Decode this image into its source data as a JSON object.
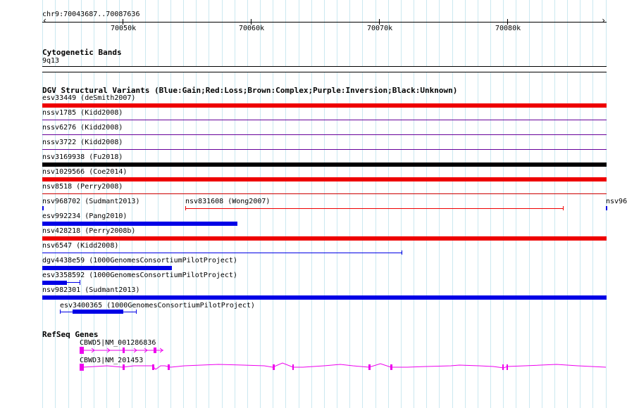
{
  "ruler": {
    "region": "chr9:70043687..70087636",
    "ticks": [
      "70050k",
      "70060k",
      "70070k",
      "70080k"
    ]
  },
  "cytoband": {
    "title": "Cytogenetic Bands",
    "band": "9q13"
  },
  "dgv": {
    "title": "DGV Structural Variants (Blue:Gain;Red:Loss;Brown:Complex;Purple:Inversion;Black:Unknown)",
    "colors": {
      "gain": "#0000e6",
      "loss": "#ee0000",
      "inversion": "#660099",
      "unknown": "#000000"
    },
    "variants": [
      {
        "id": "esv33449",
        "label": "esv33449 (deSmith2007)",
        "type": "loss"
      },
      {
        "id": "nssv1785",
        "label": "nssv1785 (Kidd2008)",
        "type": "inversion"
      },
      {
        "id": "nssv6276",
        "label": "nssv6276 (Kidd2008)",
        "type": "inversion"
      },
      {
        "id": "nssv3722",
        "label": "nssv3722 (Kidd2008)",
        "type": "inversion"
      },
      {
        "id": "nsv3169938",
        "label": "nsv3169938 (Fu2018)",
        "type": "unknown"
      },
      {
        "id": "nsv1029566",
        "label": "nsv1029566 (Coe2014)",
        "type": "loss"
      },
      {
        "id": "nsv8518",
        "label": "nsv8518 (Perry2008)",
        "type": "loss"
      },
      {
        "id": "nsv968702",
        "label": "nsv968702 (Sudmant2013)",
        "type": "gain"
      },
      {
        "id": "nsv831608",
        "label": "nsv831608 (Wong2007)",
        "type": "loss"
      },
      {
        "id": "nsv96",
        "label": "nsv96",
        "type": "gain"
      },
      {
        "id": "esv992234",
        "label": "esv992234 (Pang2010)",
        "type": "gain"
      },
      {
        "id": "nsv428218",
        "label": "nsv428218 (Perry2008b)",
        "type": "loss"
      },
      {
        "id": "nsv6547",
        "label": "nsv6547 (Kidd2008)",
        "type": "gain"
      },
      {
        "id": "dgv4438e59",
        "label": "dgv4438e59 (1000GenomesConsortiumPilotProject)",
        "type": "gain"
      },
      {
        "id": "esv3358592",
        "label": "esv3358592 (1000GenomesConsortiumPilotProject)",
        "type": "gain"
      },
      {
        "id": "nsv982301",
        "label": "nsv982301 (Sudmant2013)",
        "type": "gain"
      },
      {
        "id": "esv3400365",
        "label": "esv3400365 (1000GenomesConsortiumPilotProject)",
        "type": "gain"
      }
    ]
  },
  "refseq": {
    "title": "RefSeq Genes",
    "color": "#ee00ee",
    "genes": [
      {
        "label": "CBWD5|NM_001286836"
      },
      {
        "label": "CBWD3|NM_201453"
      }
    ]
  }
}
